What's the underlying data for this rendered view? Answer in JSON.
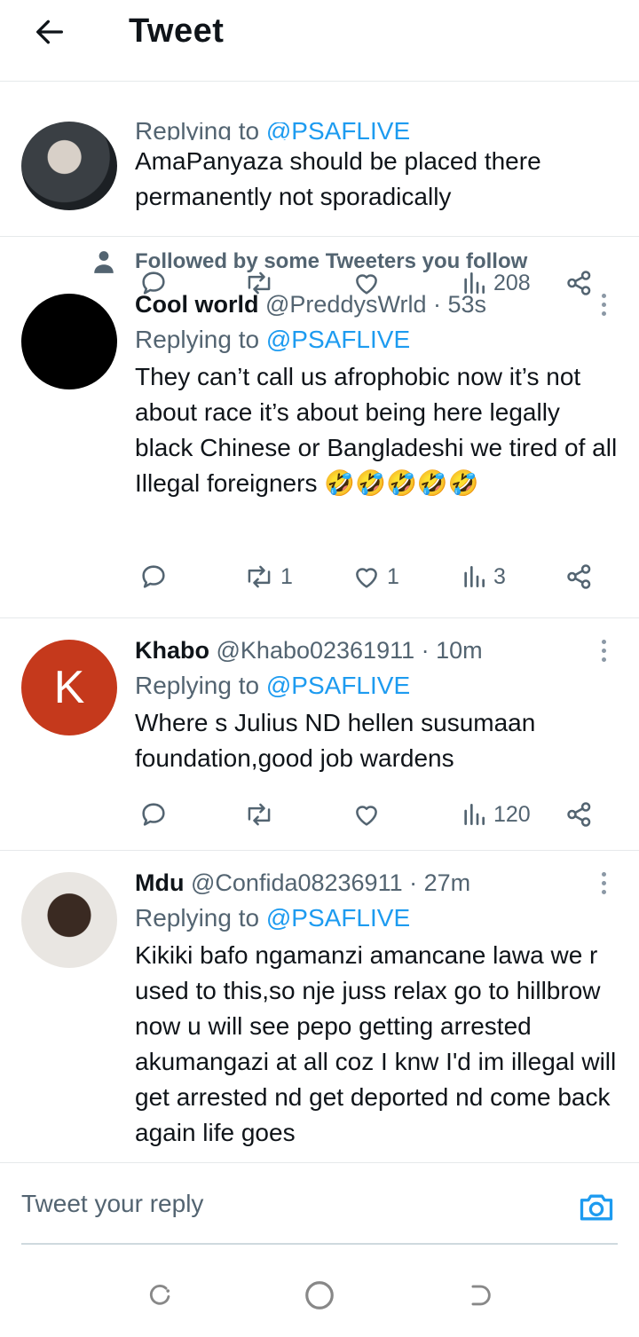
{
  "header": {
    "title": "Tweet"
  },
  "tweets": [
    {
      "reply_prefix": "Replying to",
      "reply_handle": "@PSAFLIVE",
      "text": "AmaPanyaza should be placed there permanently not sporadically",
      "stats": {
        "replies": "",
        "retweets": "",
        "likes": "",
        "views": "208"
      }
    },
    {
      "social_context": "Followed by some Tweeters you follow",
      "name": "Cool world",
      "handle": "@PreddysWrld",
      "time": "· 53s",
      "reply_prefix": "Replying to",
      "reply_handle": "@PSAFLIVE",
      "text": "They can’t call us afrophobic now it’s not about race it’s about being here legally black Chinese or Bangladeshi we tired of all Illegal foreigners 🤣🤣🤣🤣🤣",
      "stats": {
        "replies": "",
        "retweets": "1",
        "likes": "1",
        "views": "3"
      }
    },
    {
      "name": "Khabo",
      "handle": "@Khabo02361911",
      "time": "· 10m",
      "avatar_letter": "K",
      "reply_prefix": "Replying to",
      "reply_handle": "@PSAFLIVE",
      "text": "Where s Julius ND hellen susumaan foundation,good job wardens",
      "stats": {
        "replies": "",
        "retweets": "",
        "likes": "",
        "views": "120"
      }
    },
    {
      "name": "Mdu",
      "handle": "@Confida08236911",
      "time": "· 27m",
      "reply_prefix": "Replying to",
      "reply_handle": "@PSAFLIVE",
      "text": "Kikiki bafo ngamanzi amancane lawa we r used to this,so nje juss relax go to hillbrow now u will see pepo getting arrested akumangazi at all coz I knw I'd im illegal will get arrested nd get deported nd come back again life goes"
    }
  ],
  "compose": {
    "placeholder": "Tweet your reply"
  },
  "colors": {
    "accent": "#1d9bf0",
    "text": "#0f1419",
    "muted": "#536471",
    "divider": "#e6e9eb"
  }
}
